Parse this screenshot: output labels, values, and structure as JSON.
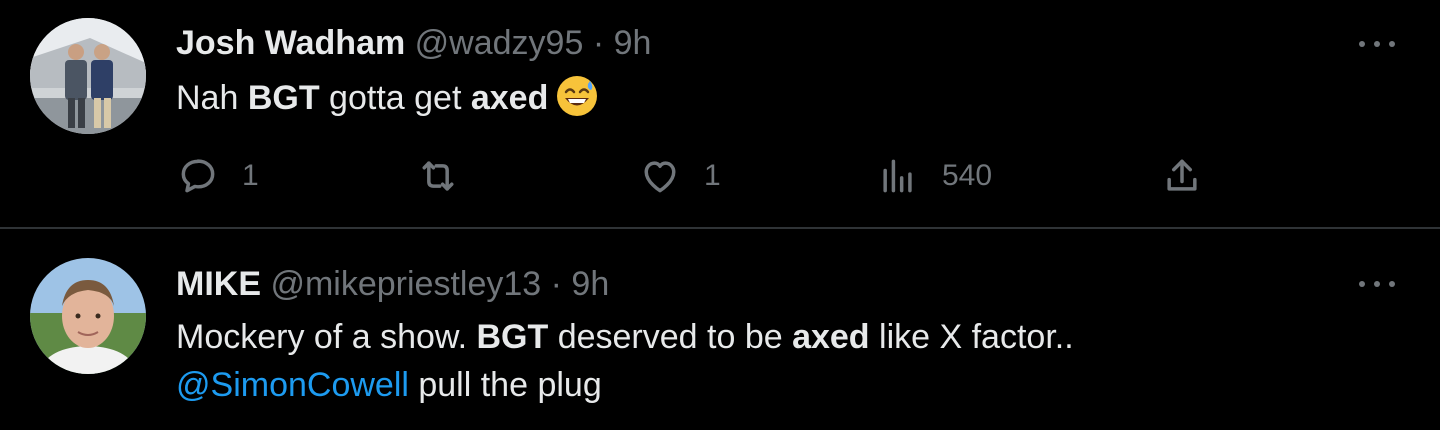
{
  "tweets": [
    {
      "name": "Josh Wadham",
      "handle": "@wadzy95",
      "separator": "·",
      "time": "9h",
      "text_parts": [
        "Nah ",
        "BGT",
        " gotta get ",
        "axed"
      ],
      "emoji": "grinning-face-with-sweat",
      "actions": {
        "replies": "1",
        "retweets": "",
        "likes": "1",
        "views": "540"
      }
    },
    {
      "name": "MIKE",
      "handle": "@mikepriestley13",
      "separator": "·",
      "time": "9h",
      "line1_parts": [
        "Mockery of a show. ",
        "BGT",
        " deserved to be ",
        "axed",
        " like X factor.."
      ],
      "line2_mention": "@SimonCowell",
      "line2_rest": " pull the plug"
    }
  ],
  "colors": {
    "background": "#000000",
    "text": "#e7e9ea",
    "muted": "#71767b",
    "link": "#1d9bf0",
    "divider": "#2f3336"
  },
  "icons": [
    "reply-icon",
    "retweet-icon",
    "like-icon",
    "views-icon",
    "share-icon",
    "more-icon"
  ]
}
